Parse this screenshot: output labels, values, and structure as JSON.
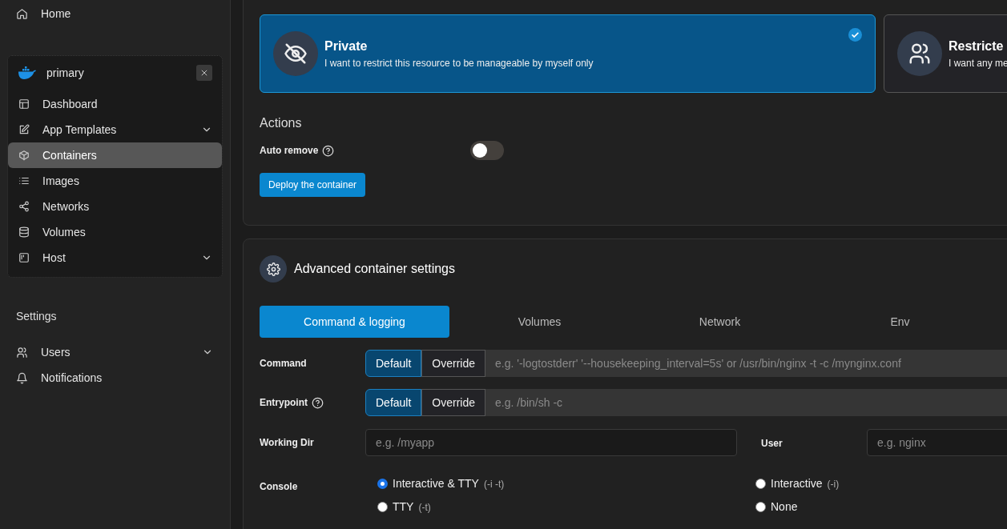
{
  "sidebar": {
    "home": {
      "label": "Home"
    },
    "environment": {
      "name": "primary",
      "items": [
        {
          "label": "Dashboard",
          "kind": "layout",
          "expandable": false,
          "selected": false
        },
        {
          "label": "App Templates",
          "kind": "edit",
          "expandable": true,
          "selected": false
        },
        {
          "label": "Containers",
          "kind": "box",
          "expandable": false,
          "selected": true
        },
        {
          "label": "Images",
          "kind": "list",
          "expandable": false,
          "selected": false
        },
        {
          "label": "Networks",
          "kind": "share",
          "expandable": false,
          "selected": false
        },
        {
          "label": "Volumes",
          "kind": "database",
          "expandable": false,
          "selected": false
        },
        {
          "label": "Host",
          "kind": "board",
          "expandable": true,
          "selected": false
        }
      ]
    },
    "settings": {
      "heading": "Settings",
      "items": [
        {
          "label": "Users",
          "kind": "users",
          "expandable": true
        },
        {
          "label": "Notifications",
          "kind": "bell",
          "expandable": false
        }
      ]
    }
  },
  "access_options": [
    {
      "title": "Private",
      "description": "I want to restrict this resource to be manageable by myself only",
      "kind": "eye-off",
      "selected": true
    },
    {
      "title": "Restricte",
      "description": "I want any me",
      "kind": "users",
      "selected": false
    }
  ],
  "actions": {
    "heading": "Actions",
    "auto_remove": {
      "label": "Auto remove",
      "on": false
    },
    "deploy_button": "Deploy the container"
  },
  "advanced": {
    "title": "Advanced container settings",
    "tabs": [
      {
        "label": "Command & logging",
        "selected": true
      },
      {
        "label": "Volumes",
        "selected": false
      },
      {
        "label": "Network",
        "selected": false
      },
      {
        "label": "Env",
        "selected": false
      }
    ],
    "command": {
      "label": "Command",
      "help": false,
      "options": [
        {
          "label": "Default",
          "selected": true
        },
        {
          "label": "Override",
          "selected": false
        }
      ],
      "placeholder": "e.g. '-logtostderr' '--housekeeping_interval=5s' or /usr/bin/nginx -t -c /mynginx.conf"
    },
    "entrypoint": {
      "label": "Entrypoint",
      "help": true,
      "options": [
        {
          "label": "Default",
          "selected": true
        },
        {
          "label": "Override",
          "selected": false
        }
      ],
      "placeholder": "e.g. /bin/sh -c"
    },
    "working_dir": {
      "label": "Working Dir",
      "placeholder": "e.g. /myapp"
    },
    "user": {
      "label": "User",
      "placeholder": "e.g. nginx"
    },
    "console": {
      "label": "Console",
      "options": [
        {
          "label": "Interactive & TTY",
          "flag": "(-i -t)",
          "selected": true
        },
        {
          "label": "Interactive",
          "flag": "(-i)",
          "selected": false
        },
        {
          "label": "TTY",
          "flag": "(-t)",
          "selected": false
        },
        {
          "label": "None",
          "selected": false
        }
      ]
    }
  }
}
